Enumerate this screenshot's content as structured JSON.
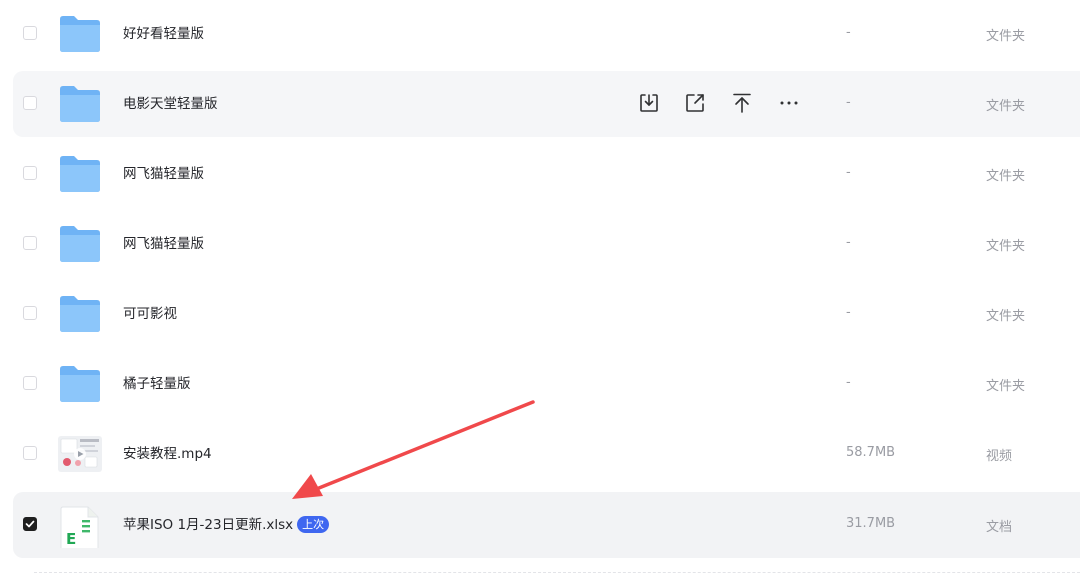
{
  "files": [
    {
      "name": "好好看轻量版",
      "size": "-",
      "type": "文件夹",
      "icon": "folder-icon",
      "checked": false
    },
    {
      "name": "电影天堂轻量版",
      "size": "-",
      "type": "文件夹",
      "icon": "folder-icon",
      "checked": false
    },
    {
      "name": "网飞猫轻量版",
      "size": "-",
      "type": "文件夹",
      "icon": "folder-icon",
      "checked": false
    },
    {
      "name": "网飞猫轻量版",
      "size": "-",
      "type": "文件夹",
      "icon": "folder-icon",
      "checked": false
    },
    {
      "name": "可可影视",
      "size": "-",
      "type": "文件夹",
      "icon": "folder-icon",
      "checked": false
    },
    {
      "name": "橘子轻量版",
      "size": "-",
      "type": "文件夹",
      "icon": "folder-icon",
      "checked": false
    },
    {
      "name": "安装教程.mp4",
      "size": "58.7MB",
      "type": "视频",
      "icon": "video-thumbnail-icon",
      "checked": false
    },
    {
      "name": "苹果ISO 1月-23日更新.xlsx",
      "size": "31.7MB",
      "type": "文档",
      "icon": "excel-file-icon",
      "checked": true,
      "badge": "上次"
    }
  ],
  "hover_actions": {
    "row_index": 1,
    "icons": [
      "download-icon",
      "share-icon",
      "upload-icon",
      "more-icon"
    ]
  },
  "colors": {
    "folder": "#7fbef7",
    "accent": "#3f67f0",
    "arrow": "#f0494b",
    "row_highlight": "#f5f6f8"
  }
}
